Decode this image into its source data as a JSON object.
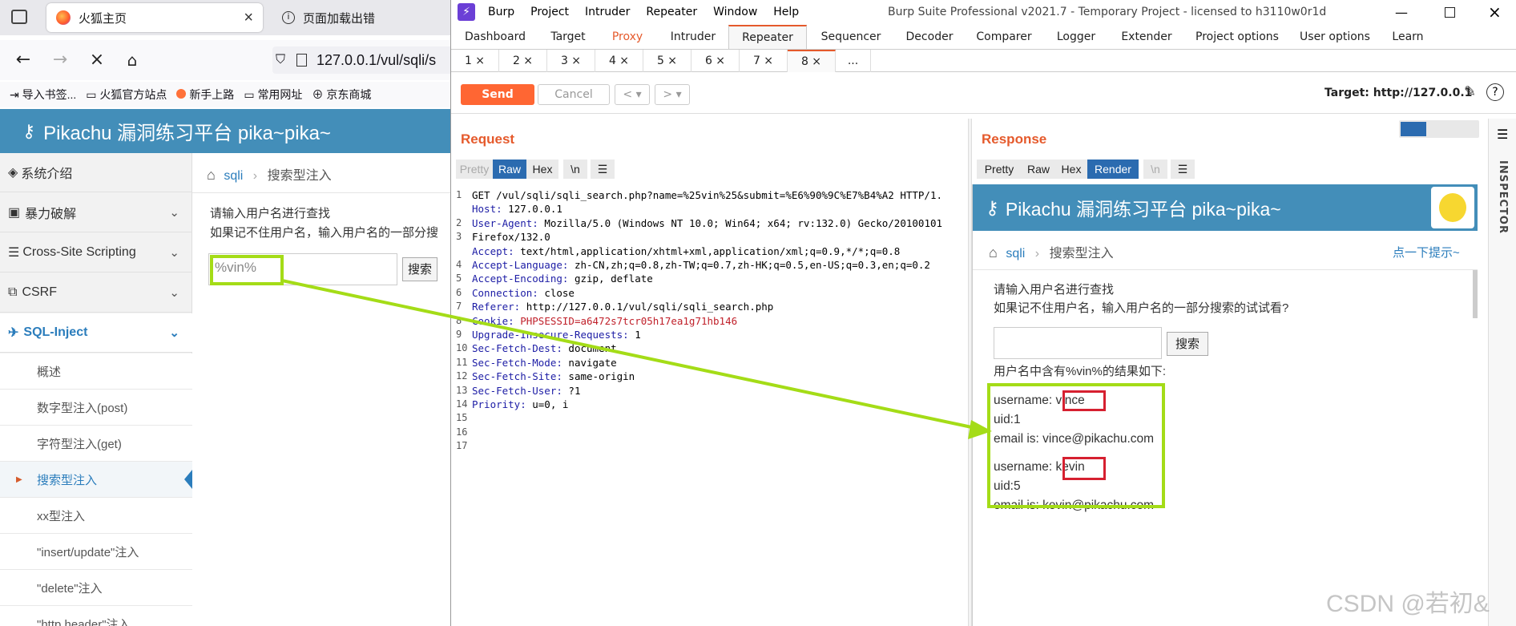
{
  "firefox": {
    "tabs": [
      {
        "title": "火狐主页",
        "close": "×"
      },
      {
        "title": "页面加载出错"
      }
    ],
    "url": "127.0.0.1/vul/sqli/s",
    "bookmarks": [
      "导入书签...",
      "火狐官方站点",
      "新手上路",
      "常用网址",
      "京东商城"
    ],
    "site_title": "Pikachu 漏洞练习平台 pika~pika~",
    "sidebar": {
      "items": [
        {
          "label": "系统介绍"
        },
        {
          "label": "暴力破解",
          "chev": "⌄"
        },
        {
          "label": "Cross-Site Scripting",
          "chev": "⌄"
        },
        {
          "label": "CSRF",
          "chev": "⌄"
        },
        {
          "label": "SQL-Inject",
          "chev": "⌄"
        }
      ],
      "subitems": [
        "概述",
        "数字型注入(post)",
        "字符型注入(get)",
        "搜索型注入",
        "xx型注入",
        "\"insert/update\"注入",
        "\"delete\"注入",
        "\"http header\"注入"
      ]
    },
    "breadcrumb": {
      "section": "sqli",
      "sep": "›",
      "page": "搜索型注入"
    },
    "prompt_line1": "请输入用户名进行查找",
    "prompt_line2": "如果记不住用户名，输入用户名的一部分搜",
    "search_value": "%vin%",
    "search_button": "搜索"
  },
  "burp": {
    "menu": [
      "Burp",
      "Project",
      "Intruder",
      "Repeater",
      "Window",
      "Help"
    ],
    "window_title": "Burp Suite Professional v2021.7 - Temporary Project - licensed to h3110w0r1d",
    "main_tabs": [
      "Dashboard",
      "Target",
      "Proxy",
      "Intruder",
      "Repeater",
      "Sequencer",
      "Decoder",
      "Comparer",
      "Logger",
      "Extender",
      "Project options",
      "User options",
      "Learn"
    ],
    "selected_main_tab": "Repeater",
    "repeater_tabs": [
      "1 ×",
      "2 ×",
      "3 ×",
      "4 ×",
      "5 ×",
      "6 ×",
      "7 ×",
      "8 ×",
      "..."
    ],
    "send_label": "Send",
    "cancel_label": "Cancel",
    "target_label": "Target: http://127.0.0.1",
    "request_title": "Request",
    "response_title": "Response",
    "request_views": [
      "Pretty",
      "Raw",
      "Hex",
      "\\n"
    ],
    "response_views": [
      "Pretty",
      "Raw",
      "Hex",
      "Render",
      "\\n"
    ],
    "inspector_label": "INSPECTOR",
    "request_lines": [
      "GET /vul/sqli/sqli_search.php?name=%25vin%25&submit=%E6%90%9C%E7%B4%A2 HTTP/1.",
      "Host: 127.0.0.1",
      "User-Agent: Mozilla/5.0 (Windows NT 10.0; Win64; x64; rv:132.0) Gecko/20100101",
      "Firefox/132.0",
      "Accept: text/html,application/xhtml+xml,application/xml;q=0.9,*/*;q=0.8",
      "Accept-Language: zh-CN,zh;q=0.8,zh-TW;q=0.7,zh-HK;q=0.5,en-US;q=0.3,en;q=0.2",
      "Accept-Encoding: gzip, deflate",
      "Connection: close",
      "Referer: http://127.0.0.1/vul/sqli/sqli_search.php",
      "Cookie: PHPSESSID=a6472s7tcr05h17ea1g71hb146",
      "Upgrade-Insecure-Requests: 1",
      "Sec-Fetch-Dest: document",
      "Sec-Fetch-Mode: navigate",
      "Sec-Fetch-Site: same-origin",
      "Sec-Fetch-User: ?1",
      "Priority: u=0, i",
      "",
      ""
    ],
    "line_numbers": [
      "1",
      "",
      "2",
      "3",
      "",
      "4",
      "5",
      "6",
      "7",
      "8",
      "9",
      "10",
      "11",
      "12",
      "13",
      "14",
      "15",
      "16",
      "17"
    ],
    "render": {
      "title": "Pikachu 漏洞练习平台 pika~pika~",
      "breadcrumb_section": "sqli",
      "breadcrumb_sep": "›",
      "breadcrumb_page": "搜索型注入",
      "hint": "点一下提示~",
      "prompt_line1": "请输入用户名进行查找",
      "prompt_line2": "如果记不住用户名，输入用户名的一部分搜索的试试看?",
      "search_button": "搜索",
      "result_header": "用户名中含有%vin%的结果如下:",
      "results": [
        {
          "username_label": "username:",
          "username": "vince",
          "uid": "uid:1",
          "email": "email is: vince@pikachu.com"
        },
        {
          "username_label": "username:",
          "username": "kevin",
          "uid": "uid:5",
          "email": "email is: kevin@pikachu.com"
        }
      ]
    }
  },
  "watermark": "CSDN @若初&",
  "colors": {
    "pikachu_blue": "#438eb9",
    "burp_orange": "#e55a2c",
    "annotation_green": "#a4dc17",
    "highlight_red": "#d62030"
  }
}
